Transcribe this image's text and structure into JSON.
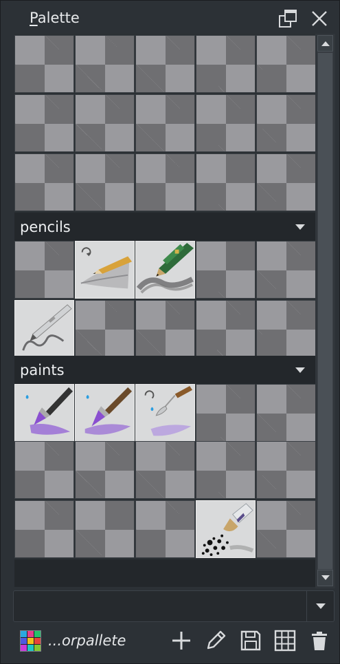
{
  "window": {
    "title": "Palette",
    "title_accel": "P",
    "title_rest": "alette"
  },
  "groups": [
    {
      "name": "pencils"
    },
    {
      "name": "paints"
    }
  ],
  "footer": {
    "palette_name": "...orpallete",
    "swatch_colors": [
      "#2aa8e0",
      "#e43d8c",
      "#26c26a",
      "#4f5be0",
      "#f2c21b",
      "#e8423a",
      "#c93bd8",
      "#1fc8c1",
      "#86c730"
    ]
  },
  "icons": [
    "float-icon",
    "close-icon",
    "scroll-up-icon",
    "scroll-down-icon",
    "chevron-down-icon",
    "add-icon",
    "edit-icon",
    "save-icon",
    "grid-icon",
    "delete-icon"
  ]
}
